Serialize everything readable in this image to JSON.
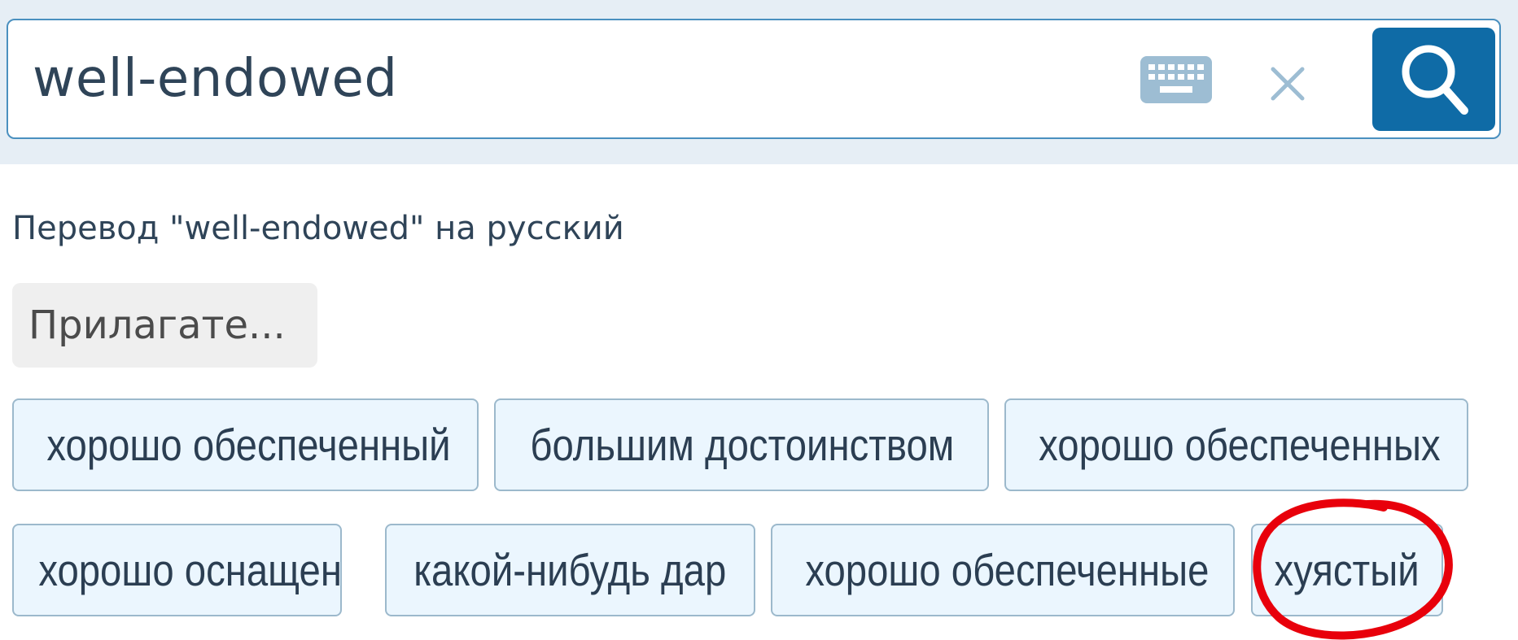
{
  "search": {
    "value": "well-endowed",
    "keyboard_icon": "keyboard-icon",
    "clear_icon": "close-icon",
    "submit_icon": "search-icon"
  },
  "heading": "Перевод \"well-endowed\" на русский",
  "part_of_speech": "Прилагате...",
  "translations": [
    "хорошо обеспеченный",
    "большим достоинством",
    "хорошо обеспеченных",
    "хорошо оснащен",
    "какой-нибудь дар",
    "хорошо обеспеченные",
    "хуястый"
  ],
  "colors": {
    "band": "#e6eef5",
    "accent": "#0f6ba6",
    "chip_bg": "#ebf6fe",
    "chip_border": "#9cb9cc",
    "text": "#2f4458",
    "annotation": "#e8000b"
  }
}
